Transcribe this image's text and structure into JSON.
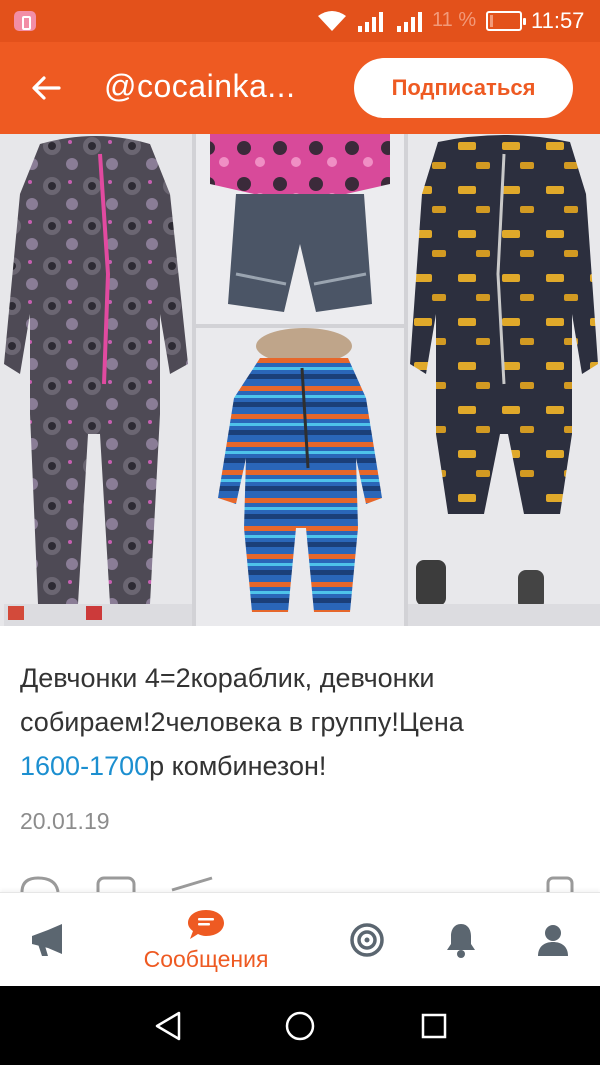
{
  "status_bar": {
    "battery_percent": "11 %",
    "battery_level": 0.11,
    "time": "11:57"
  },
  "app_bar": {
    "title": "@cocainka...",
    "subscribe_label": "Подписаться"
  },
  "post": {
    "text_line_1": "Девчонки 4=2кораблик, девчонки",
    "text_line_2": "собираем!2человека в группу!Цена",
    "price_highlight": "1600-1700",
    "text_line_3_rest": "р комбинезон!",
    "date": "20.01.19"
  },
  "tab_bar": {
    "active_tab_label": "Сообщения"
  },
  "colors": {
    "brand_orange": "#ee5a22",
    "status_orange": "#e3511b",
    "link_blue": "#1c8fd0"
  },
  "icons": [
    "back-arrow-icon",
    "megaphone-icon",
    "chat-bubble-icon",
    "target-icon",
    "bell-icon",
    "person-icon",
    "nav-back-icon",
    "nav-home-icon",
    "nav-recents-icon"
  ]
}
